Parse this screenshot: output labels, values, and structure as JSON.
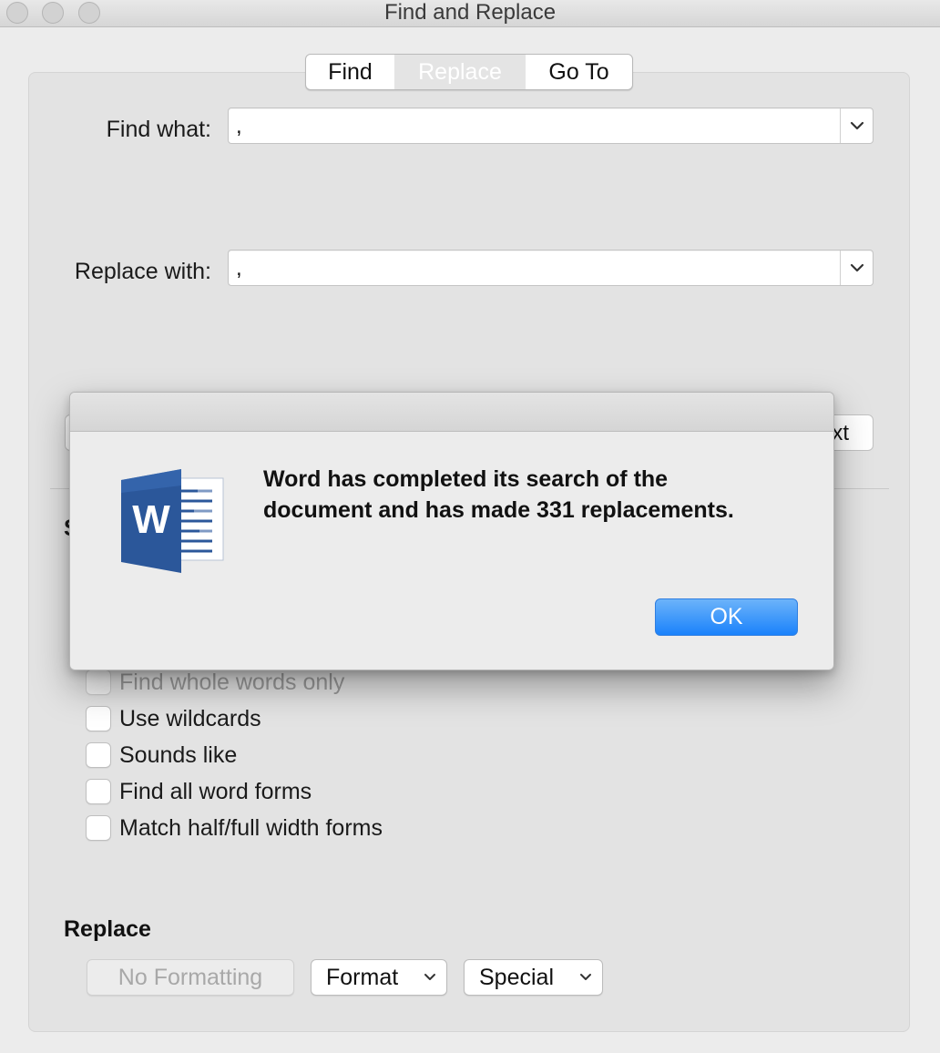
{
  "window": {
    "title": "Find and Replace"
  },
  "tabs": [
    {
      "label": "Find"
    },
    {
      "label": "Replace",
      "selected": true
    },
    {
      "label": "Go To"
    }
  ],
  "find": {
    "label": "Find what:",
    "value": ","
  },
  "replace": {
    "label": "Replace with:",
    "value": ","
  },
  "hidden_button_partial": "xt",
  "hidden_section_partial": "S",
  "options": [
    {
      "label": "Find whole words only",
      "checked": false,
      "enabled": false
    },
    {
      "label": "Use wildcards",
      "checked": false,
      "enabled": true
    },
    {
      "label": "Sounds like",
      "checked": false,
      "enabled": true
    },
    {
      "label": "Find all word forms",
      "checked": false,
      "enabled": true
    },
    {
      "label": "Match half/full width forms",
      "checked": false,
      "enabled": true
    }
  ],
  "replace_section": {
    "title": "Replace",
    "no_formatting": "No Formatting",
    "format": "Format",
    "special": "Special"
  },
  "alert": {
    "message_line1": "Word has completed its search of the",
    "message_line2": "document and has made 331 replacements.",
    "ok": "OK",
    "icon_letter": "W"
  },
  "colors": {
    "accent": "#1a82fb",
    "word_blue": "#2b579a"
  }
}
